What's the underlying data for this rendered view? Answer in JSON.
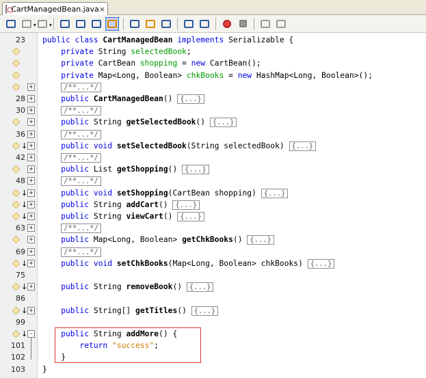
{
  "tab": {
    "title": "CartManagedBean.java",
    "close_label": "×"
  },
  "toolbar": {
    "buttons": [
      "back-icon",
      "forward-icon",
      "history-icon",
      "find-selection-icon",
      "find-previous-icon",
      "find-next-icon",
      "toggle-highlight-icon",
      "previous-bookmark-icon",
      "next-bookmark-icon",
      "toggle-bookmark-icon",
      "shift-left-icon",
      "shift-right-icon",
      "record-macro-icon",
      "stop-macro-icon",
      "comment-icon",
      "uncomment-icon"
    ]
  },
  "lines": [
    {
      "ln": "23",
      "mark": false,
      "arrow": false,
      "fold": "",
      "segs": [
        {
          "t": "public ",
          "c": "kw"
        },
        {
          "t": "class ",
          "c": "kw"
        },
        {
          "t": "CartManagedBean ",
          "c": "b"
        },
        {
          "t": "implements ",
          "c": "kw"
        },
        {
          "t": "Serializable {",
          "c": ""
        }
      ]
    },
    {
      "ln": "",
      "mark": true,
      "arrow": false,
      "fold": "",
      "segs": [
        {
          "t": "    private ",
          "c": "kw"
        },
        {
          "t": "String ",
          "c": ""
        },
        {
          "t": "selectedBook",
          "c": "fd"
        },
        {
          "t": ";",
          "c": ""
        }
      ]
    },
    {
      "ln": "",
      "mark": true,
      "arrow": false,
      "fold": "",
      "segs": [
        {
          "t": "    private ",
          "c": "kw"
        },
        {
          "t": "CartBean ",
          "c": ""
        },
        {
          "t": "shopping",
          "c": "fd"
        },
        {
          "t": " = ",
          "c": ""
        },
        {
          "t": "new ",
          "c": "kw"
        },
        {
          "t": "CartBean();",
          "c": ""
        }
      ]
    },
    {
      "ln": "",
      "mark": true,
      "arrow": false,
      "fold": "",
      "segs": [
        {
          "t": "    private ",
          "c": "kw"
        },
        {
          "t": "Map<Long, Boolean> ",
          "c": ""
        },
        {
          "t": "chkBooks",
          "c": "fd"
        },
        {
          "t": " = ",
          "c": ""
        },
        {
          "t": "new ",
          "c": "kw"
        },
        {
          "t": "HashMap<Long, Boolean>();",
          "c": ""
        }
      ]
    },
    {
      "ln": "",
      "mark": true,
      "arrow": false,
      "fold": "+",
      "segs": [
        {
          "t": "    ",
          "c": ""
        },
        {
          "t": "/**...*/",
          "c": "coll"
        }
      ]
    },
    {
      "ln": "28",
      "mark": false,
      "arrow": false,
      "fold": "+",
      "segs": [
        {
          "t": "    public ",
          "c": "kw"
        },
        {
          "t": "CartManagedBean",
          "c": "b"
        },
        {
          "t": "() ",
          "c": ""
        },
        {
          "t": "{...}",
          "c": "coll"
        }
      ]
    },
    {
      "ln": "30",
      "mark": false,
      "arrow": false,
      "fold": "+",
      "segs": [
        {
          "t": "    ",
          "c": ""
        },
        {
          "t": "/**...*/",
          "c": "coll"
        }
      ]
    },
    {
      "ln": "",
      "mark": true,
      "arrow": false,
      "fold": "+",
      "segs": [
        {
          "t": "    public ",
          "c": "kw"
        },
        {
          "t": "String ",
          "c": ""
        },
        {
          "t": "getSelectedBook",
          "c": "b"
        },
        {
          "t": "() ",
          "c": ""
        },
        {
          "t": "{...}",
          "c": "coll"
        }
      ]
    },
    {
      "ln": "36",
      "mark": false,
      "arrow": false,
      "fold": "+",
      "segs": [
        {
          "t": "    ",
          "c": ""
        },
        {
          "t": "/**...*/",
          "c": "coll"
        }
      ]
    },
    {
      "ln": "",
      "mark": true,
      "arrow": true,
      "fold": "+",
      "segs": [
        {
          "t": "    public ",
          "c": "kw"
        },
        {
          "t": "void ",
          "c": "kw"
        },
        {
          "t": "setSelectedBook",
          "c": "b"
        },
        {
          "t": "(String selectedBook) ",
          "c": ""
        },
        {
          "t": "{...}",
          "c": "coll"
        }
      ]
    },
    {
      "ln": "42",
      "mark": false,
      "arrow": false,
      "fold": "+",
      "segs": [
        {
          "t": "    ",
          "c": ""
        },
        {
          "t": "/**...*/",
          "c": "coll"
        }
      ]
    },
    {
      "ln": "",
      "mark": true,
      "arrow": false,
      "fold": "+",
      "segs": [
        {
          "t": "    public ",
          "c": "kw"
        },
        {
          "t": "List ",
          "c": ""
        },
        {
          "t": "getShopping",
          "c": "b"
        },
        {
          "t": "() ",
          "c": ""
        },
        {
          "t": "{...}",
          "c": "coll"
        }
      ]
    },
    {
      "ln": "48",
      "mark": false,
      "arrow": false,
      "fold": "+",
      "segs": [
        {
          "t": "    ",
          "c": ""
        },
        {
          "t": "/**...*/",
          "c": "coll"
        }
      ]
    },
    {
      "ln": "",
      "mark": true,
      "arrow": true,
      "fold": "+",
      "segs": [
        {
          "t": "    public ",
          "c": "kw"
        },
        {
          "t": "void ",
          "c": "kw"
        },
        {
          "t": "setShopping",
          "c": "b"
        },
        {
          "t": "(CartBean shopping) ",
          "c": ""
        },
        {
          "t": "{...}",
          "c": "coll"
        }
      ]
    },
    {
      "ln": "",
      "mark": true,
      "arrow": true,
      "fold": "+",
      "segs": [
        {
          "t": "    public ",
          "c": "kw"
        },
        {
          "t": "String ",
          "c": ""
        },
        {
          "t": "addCart",
          "c": "b"
        },
        {
          "t": "() ",
          "c": ""
        },
        {
          "t": "{...}",
          "c": "coll"
        }
      ]
    },
    {
      "ln": "",
      "mark": true,
      "arrow": true,
      "fold": "+",
      "segs": [
        {
          "t": "    public ",
          "c": "kw"
        },
        {
          "t": "String ",
          "c": ""
        },
        {
          "t": "viewCart",
          "c": "b"
        },
        {
          "t": "() ",
          "c": ""
        },
        {
          "t": "{...}",
          "c": "coll"
        }
      ]
    },
    {
      "ln": "63",
      "mark": false,
      "arrow": false,
      "fold": "+",
      "segs": [
        {
          "t": "    ",
          "c": ""
        },
        {
          "t": "/**...*/",
          "c": "coll"
        }
      ]
    },
    {
      "ln": "",
      "mark": true,
      "arrow": false,
      "fold": "+",
      "segs": [
        {
          "t": "    public ",
          "c": "kw"
        },
        {
          "t": "Map<Long, Boolean> ",
          "c": ""
        },
        {
          "t": "getChkBooks",
          "c": "b"
        },
        {
          "t": "() ",
          "c": ""
        },
        {
          "t": "{...}",
          "c": "coll"
        }
      ]
    },
    {
      "ln": "69",
      "mark": false,
      "arrow": false,
      "fold": "+",
      "segs": [
        {
          "t": "    ",
          "c": ""
        },
        {
          "t": "/**...*/",
          "c": "coll"
        }
      ]
    },
    {
      "ln": "",
      "mark": true,
      "arrow": true,
      "fold": "+",
      "segs": [
        {
          "t": "    public ",
          "c": "kw"
        },
        {
          "t": "void ",
          "c": "kw"
        },
        {
          "t": "setChkBooks",
          "c": "b"
        },
        {
          "t": "(Map<Long, Boolean> chkBooks) ",
          "c": ""
        },
        {
          "t": "{...}",
          "c": "coll"
        }
      ]
    },
    {
      "ln": "75",
      "mark": false,
      "arrow": false,
      "fold": "",
      "segs": []
    },
    {
      "ln": "",
      "mark": true,
      "arrow": true,
      "fold": "+",
      "segs": [
        {
          "t": "    public ",
          "c": "kw"
        },
        {
          "t": "String ",
          "c": ""
        },
        {
          "t": "removeBook",
          "c": "b"
        },
        {
          "t": "() ",
          "c": ""
        },
        {
          "t": "{...}",
          "c": "coll"
        }
      ]
    },
    {
      "ln": "86",
      "mark": false,
      "arrow": false,
      "fold": "",
      "segs": []
    },
    {
      "ln": "",
      "mark": true,
      "arrow": true,
      "fold": "+",
      "segs": [
        {
          "t": "    public ",
          "c": "kw"
        },
        {
          "t": "String[] ",
          "c": ""
        },
        {
          "t": "getTitles",
          "c": "b"
        },
        {
          "t": "() ",
          "c": ""
        },
        {
          "t": "{...}",
          "c": "coll"
        }
      ]
    },
    {
      "ln": "99",
      "mark": false,
      "arrow": false,
      "fold": "",
      "segs": []
    },
    {
      "ln": "",
      "mark": true,
      "arrow": true,
      "fold": "-",
      "segs": [
        {
          "t": "    public ",
          "c": "kw"
        },
        {
          "t": "String ",
          "c": ""
        },
        {
          "t": "addMore",
          "c": "b"
        },
        {
          "t": "() {",
          "c": ""
        }
      ]
    },
    {
      "ln": "101",
      "mark": false,
      "arrow": false,
      "fold": "",
      "segs": [
        {
          "t": "        return ",
          "c": "kw"
        },
        {
          "t": "\"success\"",
          "c": "str"
        },
        {
          "t": ";",
          "c": ""
        }
      ]
    },
    {
      "ln": "102",
      "mark": false,
      "arrow": false,
      "fold": "",
      "segs": [
        {
          "t": "    }",
          "c": ""
        }
      ]
    },
    {
      "ln": "103",
      "mark": false,
      "arrow": false,
      "fold": "",
      "segs": [
        {
          "t": "}",
          "c": ""
        }
      ]
    }
  ]
}
